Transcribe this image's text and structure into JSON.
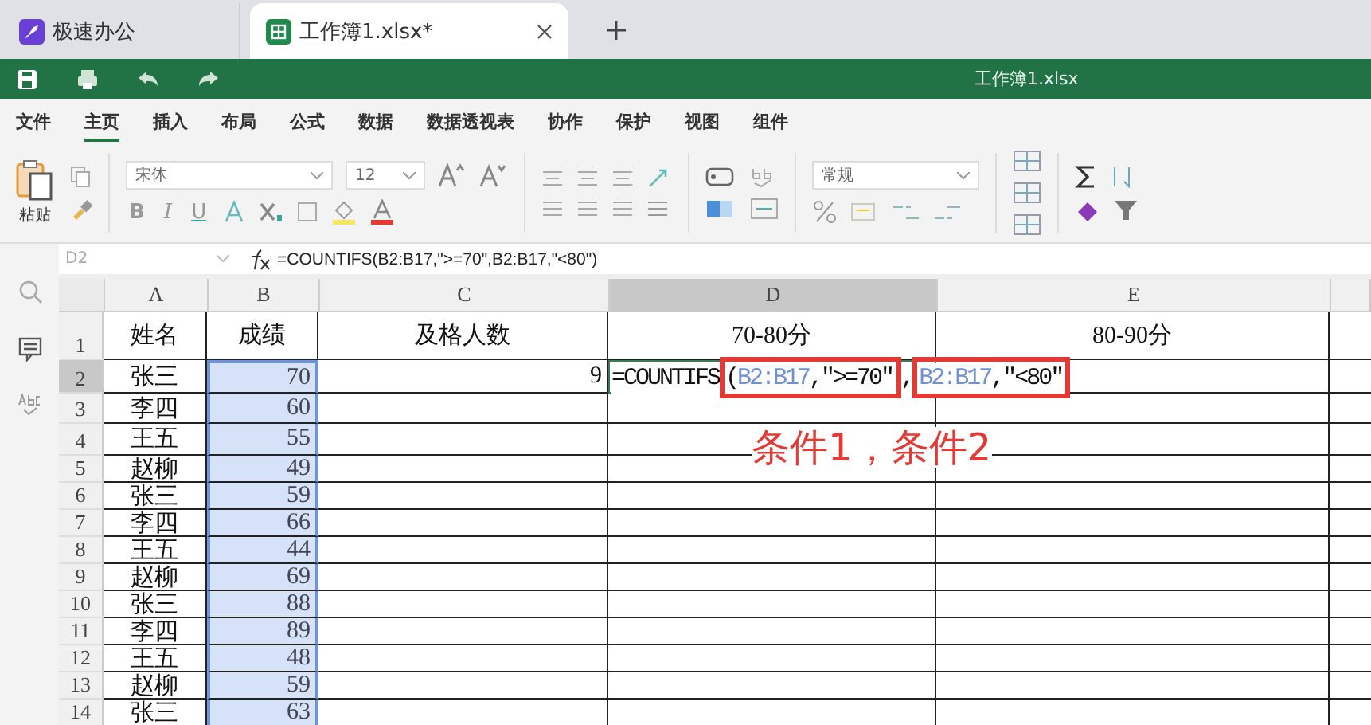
{
  "tabs": [
    {
      "label": "极速办公",
      "selected": false,
      "kind": "app"
    },
    {
      "label": "工作簿1.xlsx*",
      "selected": true,
      "kind": "sheet"
    }
  ],
  "title_bar": {
    "title": "工作簿1.xlsx"
  },
  "menu": [
    {
      "label": "文件",
      "selected": false
    },
    {
      "label": "主页",
      "selected": true
    },
    {
      "label": "插入",
      "selected": false
    },
    {
      "label": "布局",
      "selected": false
    },
    {
      "label": "公式",
      "selected": false
    },
    {
      "label": "数据",
      "selected": false
    },
    {
      "label": "数据透视表",
      "selected": false
    },
    {
      "label": "协作",
      "selected": false
    },
    {
      "label": "保护",
      "selected": false
    },
    {
      "label": "视图",
      "selected": false
    },
    {
      "label": "组件",
      "selected": false
    }
  ],
  "ribbon": {
    "paste_label": "粘贴",
    "font": "宋体",
    "size": "12",
    "format_buttons": [
      "B",
      "I",
      "U"
    ],
    "number_format": "常规"
  },
  "formula_bar": {
    "cell": "D2",
    "formula": "=COUNTIFS(B2:B17,\">=70\",B2:B17,\"<80\")"
  },
  "sheet": {
    "columns": [
      {
        "label": "A",
        "selected": false,
        "highlighted": false
      },
      {
        "label": "B",
        "selected": false,
        "highlighted": true
      },
      {
        "label": "C",
        "selected": false,
        "highlighted": false
      },
      {
        "label": "D",
        "selected": true,
        "highlighted": false
      },
      {
        "label": "E",
        "selected": false,
        "highlighted": false
      }
    ],
    "rows": [
      {
        "header": "1",
        "selected": false,
        "cells": [
          "姓名",
          "成绩",
          "及格人数",
          "70-80分",
          "80-90分"
        ]
      },
      {
        "header": "2",
        "selected": true,
        "cells": [
          "张三",
          "70",
          "9"
        ],
        "edit": [
          {
            "kind": "text",
            "text": "=COUNTIFS"
          },
          {
            "kind": "box",
            "parts": [
              {
                "kind": "text",
                "text": "("
              },
              {
                "kind": "ref",
                "text": "B2:B17"
              },
              {
                "kind": "text",
                "text": ",\">=70\""
              }
            ]
          },
          {
            "kind": "text",
            "text": ","
          },
          {
            "kind": "box",
            "parts": [
              {
                "kind": "ref",
                "text": "B2:B17"
              },
              {
                "kind": "text",
                "text": ",\"<80\""
              }
            ]
          }
        ]
      },
      {
        "header": "3",
        "selected": false,
        "cells": [
          "李四",
          "60"
        ]
      },
      {
        "header": "4",
        "selected": false,
        "cells": [
          "王五",
          "55"
        ]
      },
      {
        "header": "5",
        "selected": false,
        "cells": [
          "赵柳",
          "49"
        ]
      },
      {
        "header": "6",
        "selected": false,
        "cells": [
          "张三",
          "59"
        ]
      },
      {
        "header": "7",
        "selected": false,
        "cells": [
          "李四",
          "66"
        ]
      },
      {
        "header": "8",
        "selected": false,
        "cells": [
          "王五",
          "44"
        ]
      },
      {
        "header": "9",
        "selected": false,
        "cells": [
          "赵柳",
          "69"
        ]
      },
      {
        "header": "10",
        "selected": false,
        "cells": [
          "张三",
          "88"
        ]
      },
      {
        "header": "11",
        "selected": false,
        "cells": [
          "李四",
          "89"
        ]
      },
      {
        "header": "12",
        "selected": false,
        "cells": [
          "王五",
          "48"
        ]
      },
      {
        "header": "13",
        "selected": false,
        "cells": [
          "赵柳",
          "59"
        ]
      },
      {
        "header": "14",
        "selected": false,
        "cells": [
          "张三",
          "63"
        ]
      }
    ]
  },
  "annotation": {
    "label": "条件1，条件2"
  }
}
